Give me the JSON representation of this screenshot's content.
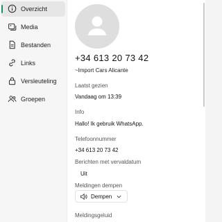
{
  "sidebar": {
    "items": [
      {
        "label": "Overzicht",
        "icon": "info-icon",
        "active": true
      },
      {
        "label": "Media",
        "icon": "media-icon",
        "active": false
      },
      {
        "label": "Bestanden",
        "icon": "document-icon",
        "active": false
      },
      {
        "label": "Links",
        "icon": "link-icon",
        "active": false
      },
      {
        "label": "Versleuteling",
        "icon": "lock-icon",
        "active": false
      },
      {
        "label": "Groepen",
        "icon": "groups-icon",
        "active": false
      }
    ]
  },
  "contact": {
    "phone": "+34 613 20 73 42",
    "name": "~Import Cars Alicante"
  },
  "last_seen": {
    "label": "Laatst gezien",
    "value": "Vandaag om 13:39"
  },
  "info": {
    "label": "Info",
    "value": "Hallo! Ik gebruik WhatsApp."
  },
  "phone_number": {
    "label": "Telefoonnummer",
    "value": "+34 613 20 73 42"
  },
  "expiring_messages": {
    "label": "Berichten met vervaldatum",
    "value": "Uit"
  },
  "mute_notifications": {
    "label": "Meldingen dempen",
    "button_label": "Dempen"
  },
  "notification_sound": {
    "label": "Meldingsgeluid"
  },
  "colors": {
    "accent": "#1f8a63",
    "active_bg": "#e6e6e6",
    "avatar_bg": "#dedede"
  }
}
